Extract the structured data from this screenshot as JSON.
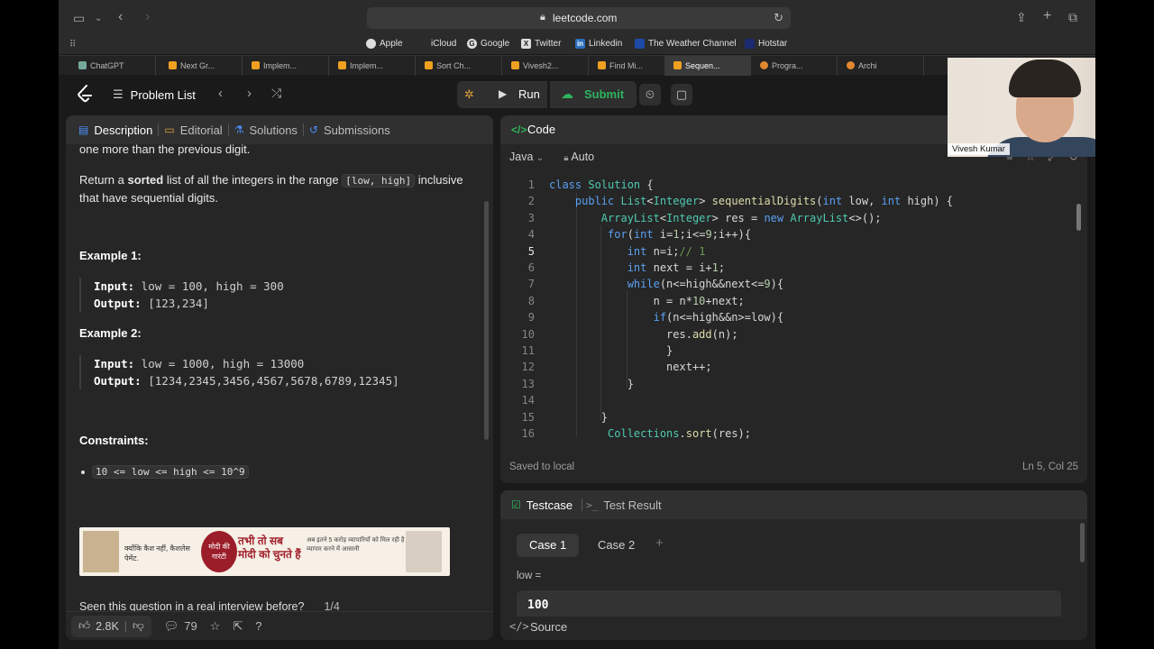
{
  "browser": {
    "url": "leetcode.com",
    "favorites": [
      {
        "label": "Apple",
        "icon": "apple-icon"
      },
      {
        "label": "iCloud",
        "icon": "apple-icon"
      },
      {
        "label": "Google",
        "icon": "google-icon"
      },
      {
        "label": "Twitter",
        "icon": "x-icon"
      },
      {
        "label": "Linkedin",
        "icon": "linkedin-icon"
      },
      {
        "label": "The Weather Channel",
        "icon": "weather-icon"
      },
      {
        "label": "Hotstar",
        "icon": "hotstar-icon"
      }
    ],
    "tabs": [
      {
        "label": "ChatGPT",
        "active": false
      },
      {
        "label": "Next Gr...",
        "active": false
      },
      {
        "label": "Implem...",
        "active": false
      },
      {
        "label": "Implem...",
        "active": false
      },
      {
        "label": "Sort Ch...",
        "active": false
      },
      {
        "label": "Vivesh2...",
        "active": false
      },
      {
        "label": "Find Mi...",
        "active": false
      },
      {
        "label": "Sequen...",
        "active": true
      },
      {
        "label": "Progra...",
        "active": false
      },
      {
        "label": "Archi",
        "active": false
      }
    ]
  },
  "header": {
    "problem_list": "Problem List",
    "run": "Run",
    "submit": "Submit",
    "premium": "m"
  },
  "left_panel": {
    "tabs": [
      {
        "label": "Description",
        "icon": "description-icon"
      },
      {
        "label": "Editorial",
        "icon": "book-icon"
      },
      {
        "label": "Solutions",
        "icon": "flask-icon"
      },
      {
        "label": "Submissions",
        "icon": "history-icon"
      }
    ],
    "intro_cont": "one more than the previous digit.",
    "return_pre": "Return a ",
    "return_bold": "sorted",
    "return_mid": " list of all the integers in the range ",
    "return_code": "[low, high]",
    "return_post": " inclusive",
    "return_line2": "that have sequential digits.",
    "example1_title": "Example 1:",
    "example1_input_label": "Input:",
    "example1_input": " low = 100, high = 300",
    "example1_output_label": "Output:",
    "example1_output": " [123,234]",
    "example2_title": "Example 2:",
    "example2_input_label": "Input:",
    "example2_input": " low = 1000, high = 13000",
    "example2_output_label": "Output:",
    "example2_output": " [1234,2345,3456,4567,5678,6789,12345]",
    "constraints_title": "Constraints:",
    "constraint1": "10 <= low <= high <= 10^9",
    "ad": {
      "left_text": "क्योंकि कैश नहीं, कैशलेस पेमेंट.",
      "seal_text": "मोदी की गारंटी",
      "headline": "तभी तो सब मोदी को चुनते हैं",
      "right_text": "अब इतने 5 करोड़ व्यापारियों को मिल रही है व्यापार करने में आसानी"
    },
    "seen_text": "Seen this question in a real interview before?",
    "seen_count": "1/4",
    "likes": "2.8K",
    "comments": "79"
  },
  "code_panel": {
    "title": "Code",
    "language": "Java",
    "mode": "Auto",
    "saved": "Saved to local",
    "cursor": "Ln 5, Col 25",
    "current_line": 5,
    "lines": [
      {
        "n": "1",
        "html": "<span class=\"kw\">class</span> <span class=\"ty\">Solution</span> {"
      },
      {
        "n": "2",
        "html": "    <span class=\"kw\">public</span> <span class=\"ty\">List</span>&lt;<span class=\"ty\">Integer</span>&gt; <span class=\"fn\">sequentialDigits</span>(<span class=\"kw\">int</span> low, <span class=\"kw\">int</span> high) {"
      },
      {
        "n": "3",
        "html": "        <span class=\"ty\">ArrayList</span>&lt;<span class=\"ty\">Integer</span>&gt; res = <span class=\"kw\">new</span> <span class=\"ty\">ArrayList</span>&lt;&gt;();"
      },
      {
        "n": "4",
        "html": "         <span class=\"kw\">for</span>(<span class=\"kw\">int</span> i=<span class=\"num\">1</span>;i&lt;=<span class=\"num\">9</span>;i++){"
      },
      {
        "n": "5",
        "html": "            <span class=\"kw\">int</span> n=i;<span class=\"cm\">// 1</span>"
      },
      {
        "n": "6",
        "html": "            <span class=\"kw\">int</span> next = i+<span class=\"num\">1</span>;"
      },
      {
        "n": "7",
        "html": "            <span class=\"kw\">while</span>(n&lt;=high&amp;&amp;next&lt;=<span class=\"num\">9</span>){"
      },
      {
        "n": "8",
        "html": "                n = n*<span class=\"num\">10</span>+next;"
      },
      {
        "n": "9",
        "html": "                <span class=\"kw\">if</span>(n&lt;=high&amp;&amp;n&gt;=low){"
      },
      {
        "n": "10",
        "html": "                  res.<span class=\"fn\">add</span>(n);"
      },
      {
        "n": "11",
        "html": "                  }"
      },
      {
        "n": "12",
        "html": "                  next++;"
      },
      {
        "n": "13",
        "html": "            }"
      },
      {
        "n": "14",
        "html": ""
      },
      {
        "n": "15",
        "html": "        }"
      },
      {
        "n": "16",
        "html": "         <span class=\"ty\">Collections</span>.<span class=\"fn\">sort</span>(res);"
      }
    ]
  },
  "test_panel": {
    "tab_testcase": "Testcase",
    "tab_result": "Test Result",
    "case1": "Case 1",
    "case2": "Case 2",
    "var_label": "low =",
    "var_value": "100",
    "source": "Source"
  },
  "webcam": {
    "name": "Vivesh Kumar"
  },
  "colors": {
    "accent_green": "#2db55d",
    "premium_orange": "#f0a020",
    "panel_bg": "#262626"
  }
}
